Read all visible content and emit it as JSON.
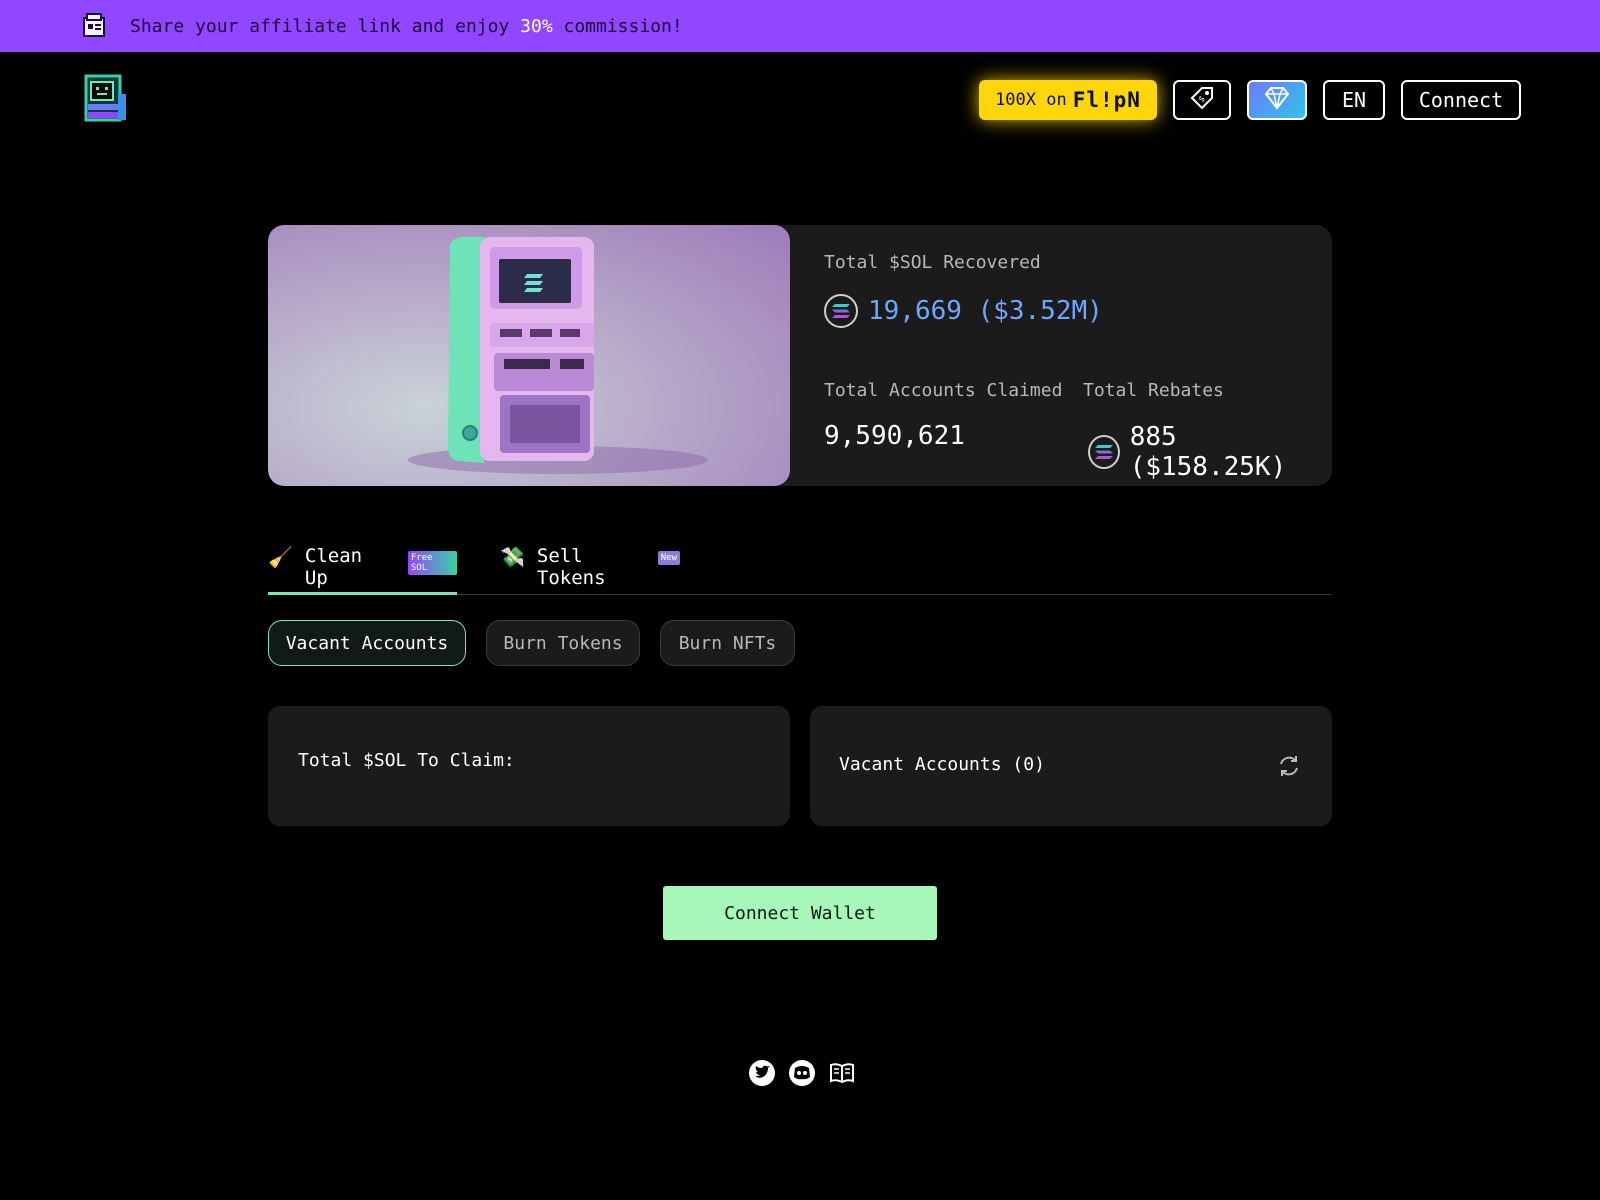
{
  "banner": {
    "icon": "affiliate-box-icon",
    "text_before": "Share your affiliate link and enjoy ",
    "text_highlight": "30%",
    "text_after": " commission!"
  },
  "header": {
    "logo": "arcade-machine-logo",
    "flip_prefix": "100X on",
    "flip_brand": "Fl!pN",
    "tag_icon": "price-tag-icon",
    "gem_icon": "diamond-icon",
    "language": "EN",
    "connect_label": "Connect"
  },
  "stats": {
    "recovered_label": "Total $SOL Recovered",
    "recovered_value": "19,669 ($3.52M)",
    "accounts_label": "Total Accounts Claimed",
    "accounts_value": "9,590,621",
    "rebates_label": "Total Rebates",
    "rebates_value": "885 ($158.25K)"
  },
  "tabs": [
    {
      "label": "Clean Up",
      "badge": "Free SOL",
      "icon": "broom-icon"
    },
    {
      "label": "Sell Tokens",
      "badge": "New",
      "icon": "money-icon"
    }
  ],
  "subtabs": [
    "Vacant Accounts",
    "Burn Tokens",
    "Burn NFTs"
  ],
  "panels": {
    "claim_label": "Total $SOL To Claim:",
    "vacant_label": "Vacant Accounts (0)"
  },
  "connect_wallet_label": "Connect Wallet",
  "colors": {
    "banner": "#9146ff",
    "accent_green": "#a6f7b9",
    "flip_yellow": "#ffd60a",
    "recovered_blue": "#6fa6ff"
  }
}
